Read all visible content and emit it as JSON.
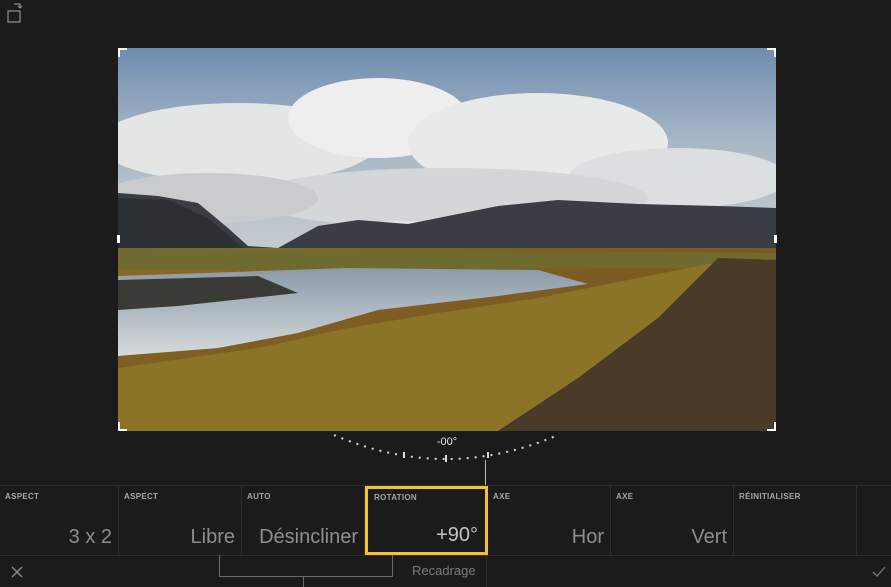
{
  "photo": {
    "description_icon": "landscape-photo"
  },
  "dial": {
    "readout": "-00°"
  },
  "options": [
    {
      "caption": "ASPECT",
      "value": "3 x 2"
    },
    {
      "caption": "ASPECT",
      "value": "Libre"
    },
    {
      "caption": "AUTO",
      "value": "Désincliner"
    },
    {
      "caption": "ROTATION",
      "value": "+90°"
    },
    {
      "caption": "AXE",
      "value": "Hor"
    },
    {
      "caption": "AXE",
      "value": "Vert"
    },
    {
      "caption": "RÉINITIALISER",
      "value": ""
    }
  ],
  "bottom_bar": {
    "mode_label": "Recadrage"
  },
  "colors": {
    "selection": "#f3c230",
    "background": "#1b1b1b"
  }
}
